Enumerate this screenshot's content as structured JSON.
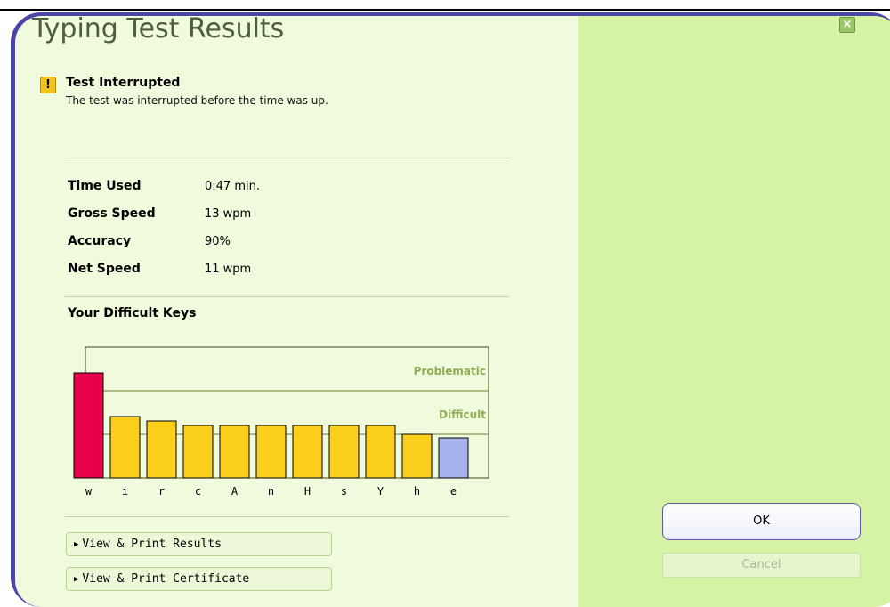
{
  "dialog": {
    "title": "Typing Test Results",
    "close_label": "×"
  },
  "notice": {
    "icon_glyph": "!",
    "title": "Test Interrupted",
    "message": "The test was interrupted before the time was up."
  },
  "stats": [
    {
      "label": "Time Used",
      "value": "0:47 min."
    },
    {
      "label": "Gross Speed",
      "value": "13 wpm"
    },
    {
      "label": "Accuracy",
      "value": "90%"
    },
    {
      "label": "Net Speed",
      "value": "11 wpm"
    }
  ],
  "difficult_keys": {
    "title": "Your Difficult Keys"
  },
  "chart_data": {
    "type": "bar",
    "categories": [
      "w",
      "i",
      "r",
      "c",
      "A",
      "n",
      "H",
      "s",
      "Y",
      "h",
      "e"
    ],
    "values": [
      118,
      69,
      64,
      59,
      59,
      59,
      59,
      59,
      59,
      49,
      45
    ],
    "ylim": [
      0,
      147
    ],
    "thresholds": [
      {
        "label": "Problematic",
        "value": 98
      },
      {
        "label": "Difficult",
        "value": 49
      }
    ],
    "colors": {
      "problematic": "#e8004a",
      "difficult": "#fccf1c",
      "ok": "#a8b2ee",
      "frame": "#3a4a18",
      "threshold_line": "#6a7d2c",
      "threshold_label": "#8fae55"
    }
  },
  "links": {
    "print_results": "View & Print Results",
    "print_certificate": "View & Print Certificate"
  },
  "buttons": {
    "ok": "OK",
    "cancel": "Cancel"
  },
  "colors": {
    "frame": "#4b45a8",
    "content_bg": "#f0fadc",
    "side_panel_bg": "#d6f2a4",
    "title_text": "#4e5d3c"
  }
}
